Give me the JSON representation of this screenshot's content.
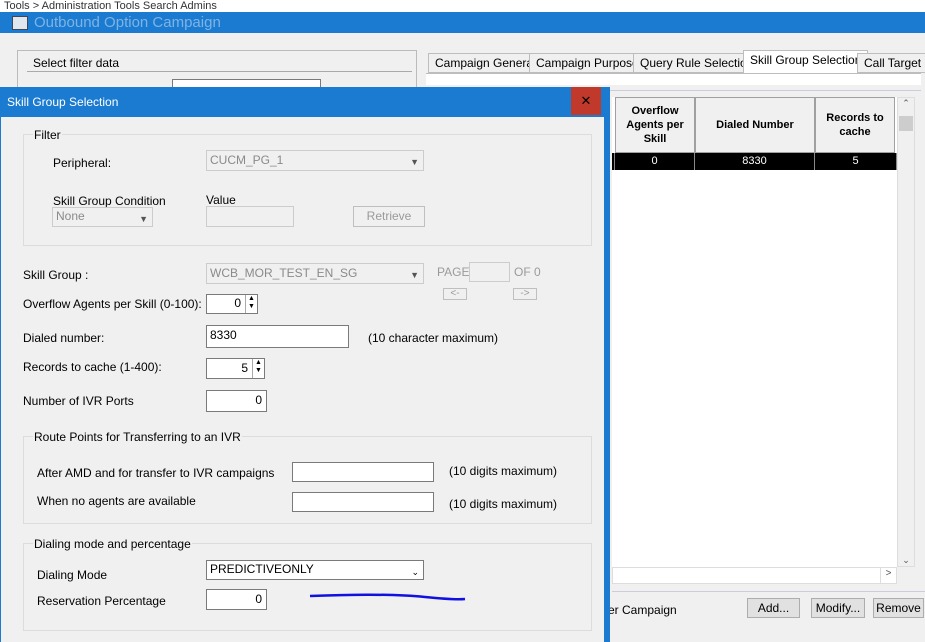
{
  "background_strip": {
    "text": "Tools > Administration Tools    Search Admins"
  },
  "main_window": {
    "title": "Outbound Option Campaign",
    "filter_group_label": "Select filter data",
    "tabs": [
      {
        "label": "Campaign General",
        "selected": false
      },
      {
        "label": "Campaign Purpose",
        "selected": false
      },
      {
        "label": "Query Rule Selection",
        "selected": false
      },
      {
        "label": "Skill Group Selection",
        "selected": true
      },
      {
        "label": "Call Target",
        "selected": false
      }
    ],
    "grid": {
      "headers": [
        "Overflow Agents per Skill",
        "Dialed Number",
        "Records to cache"
      ],
      "rows": [
        [
          "0",
          "8330",
          "5"
        ]
      ]
    },
    "partial_label": "er Campaign",
    "buttons": {
      "add": "Add...",
      "modify": "Modify...",
      "remove": "Remove"
    }
  },
  "dialog": {
    "title": "Skill Group Selection",
    "close_label": "✕",
    "filter": {
      "label": "Filter",
      "peripheral_label": "Peripheral:",
      "peripheral_value": "CUCM_PG_1",
      "condition_label": "Skill Group Condition",
      "condition_value": "None",
      "value_label": "Value",
      "value_value": "",
      "retrieve": "Retrieve"
    },
    "skill_group_label": "Skill Group :",
    "skill_group_value": "WCB_MOR_TEST_EN_SG",
    "page_label": "PAGE",
    "page_value": "",
    "of_label": "OF 0",
    "prev": "<-",
    "next": "->",
    "overflow_label": "Overflow Agents per Skill (0-100):",
    "overflow_value": "0",
    "dialed_label": "Dialed number:",
    "dialed_value": "8330",
    "dialed_hint": "(10 character maximum)",
    "records_label": "Records to cache (1-400):",
    "records_value": "5",
    "ivr_label": "Number of IVR Ports",
    "ivr_value": "0",
    "route": {
      "label": "Route Points for Transferring to an IVR",
      "amd_label": "After AMD and for transfer to IVR campaigns",
      "amd_value": "",
      "amd_hint": "(10 digits maximum)",
      "noagents_label": "When no agents are available",
      "noagents_value": "",
      "noagents_hint": "(10 digits maximum)"
    },
    "dialing": {
      "label": "Dialing mode and percentage",
      "mode_label": "Dialing Mode",
      "mode_value": "PREDICTIVEONLY",
      "reservation_label": "Reservation Percentage",
      "reservation_value": "0"
    },
    "annotation_color": "#1010e0"
  }
}
